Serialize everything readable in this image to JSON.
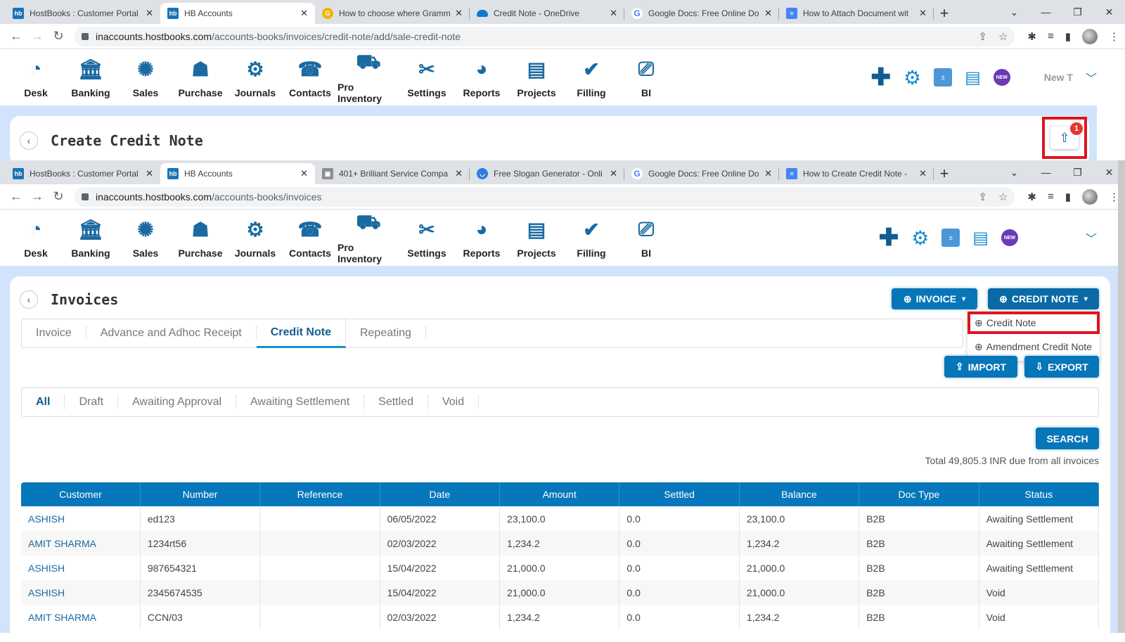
{
  "top_window": {
    "tabs": [
      {
        "title": "HostBooks : Customer Portal",
        "favicon": "hb-icon",
        "active": false
      },
      {
        "title": "HB Accounts",
        "favicon": "hb-icon",
        "active": true
      },
      {
        "title": "How to choose where Gramm",
        "favicon": "grammarly-icon",
        "active": false
      },
      {
        "title": "Credit Note - OneDrive",
        "favicon": "onedrive-icon",
        "active": false
      },
      {
        "title": "Google Docs: Free Online Do",
        "favicon": "google-icon",
        "active": false
      },
      {
        "title": "How to Attach Document wit",
        "favicon": "docs-icon",
        "active": false
      }
    ],
    "url_host": "inaccounts.hostbooks.com",
    "url_path": "/accounts-books/invoices/credit-note/add/sale-credit-note",
    "page_title": "Create Credit Note",
    "user_label": "New T",
    "upload_badge_count": "1"
  },
  "bottom_window": {
    "tabs": [
      {
        "title": "HostBooks : Customer Portal",
        "favicon": "hb-icon",
        "active": false
      },
      {
        "title": "HB Accounts",
        "favicon": "hb-icon",
        "active": true
      },
      {
        "title": "401+ Brilliant Service Compa",
        "favicon": "site-icon",
        "active": false
      },
      {
        "title": "Free Slogan Generator - Onli",
        "favicon": "slogan-icon",
        "active": false
      },
      {
        "title": "Google Docs: Free Online Do",
        "favicon": "google-icon",
        "active": false
      },
      {
        "title": "How to Create Credit Note - ",
        "favicon": "docs-icon",
        "active": false
      }
    ],
    "url_host": "inaccounts.hostbooks.com",
    "url_path": "/accounts-books/invoices",
    "page_title": "Invoices"
  },
  "app_nav": [
    {
      "label": "Desk",
      "icon": "desk-icon"
    },
    {
      "label": "Banking",
      "icon": "bank-icon"
    },
    {
      "label": "Sales",
      "icon": "sales-icon"
    },
    {
      "label": "Purchase",
      "icon": "purchase-icon"
    },
    {
      "label": "Journals",
      "icon": "journals-icon"
    },
    {
      "label": "Contacts",
      "icon": "contacts-icon"
    },
    {
      "label": "Pro Inventory",
      "icon": "inventory-icon"
    },
    {
      "label": "Settings",
      "icon": "settings-tools-icon"
    },
    {
      "label": "Reports",
      "icon": "reports-icon"
    },
    {
      "label": "Projects",
      "icon": "projects-icon"
    },
    {
      "label": "Filling",
      "icon": "filling-icon"
    },
    {
      "label": "BI",
      "icon": "bi-icon"
    }
  ],
  "actions": {
    "invoice_btn": "INVOICE",
    "credit_note_btn": "CREDIT NOTE",
    "dropdown": [
      "Credit Note",
      "Amendment Credit Note"
    ],
    "import_btn": "IMPORT",
    "export_btn": "EXPORT",
    "search_btn": "SEARCH"
  },
  "main_tabs": [
    "Invoice",
    "Advance and Adhoc Receipt",
    "Credit Note",
    "Repeating"
  ],
  "status_tabs": [
    "All",
    "Draft",
    "Awaiting Approval",
    "Awaiting Settlement",
    "Settled",
    "Void"
  ],
  "total_text": "Total 49,805.3 INR due from all invoices",
  "table": {
    "headers": [
      "Customer",
      "Number",
      "Reference",
      "Date",
      "Amount",
      "Settled",
      "Balance",
      "Doc Type",
      "Status"
    ],
    "rows": [
      [
        "ASHISH",
        "ed123",
        "",
        "06/05/2022",
        "23,100.0",
        "0.0",
        "23,100.0",
        "B2B",
        "Awaiting Settlement"
      ],
      [
        "AMIT SHARMA",
        "1234rt56",
        "",
        "02/03/2022",
        "1,234.2",
        "0.0",
        "1,234.2",
        "B2B",
        "Awaiting Settlement"
      ],
      [
        "ASHISH",
        "987654321",
        "",
        "15/04/2022",
        "21,000.0",
        "0.0",
        "21,000.0",
        "B2B",
        "Awaiting Settlement"
      ],
      [
        "ASHISH",
        "2345674535",
        "",
        "15/04/2022",
        "21,000.0",
        "0.0",
        "21,000.0",
        "B2B",
        "Void"
      ],
      [
        "AMIT SHARMA",
        "CCN/03",
        "",
        "02/03/2022",
        "1,234.2",
        "0.0",
        "1,234.2",
        "B2B",
        "Void"
      ]
    ]
  },
  "colors": {
    "brand_blue": "#0677bb",
    "highlight_red": "#e0141e",
    "new_badge_purple": "#6a3bb5"
  }
}
